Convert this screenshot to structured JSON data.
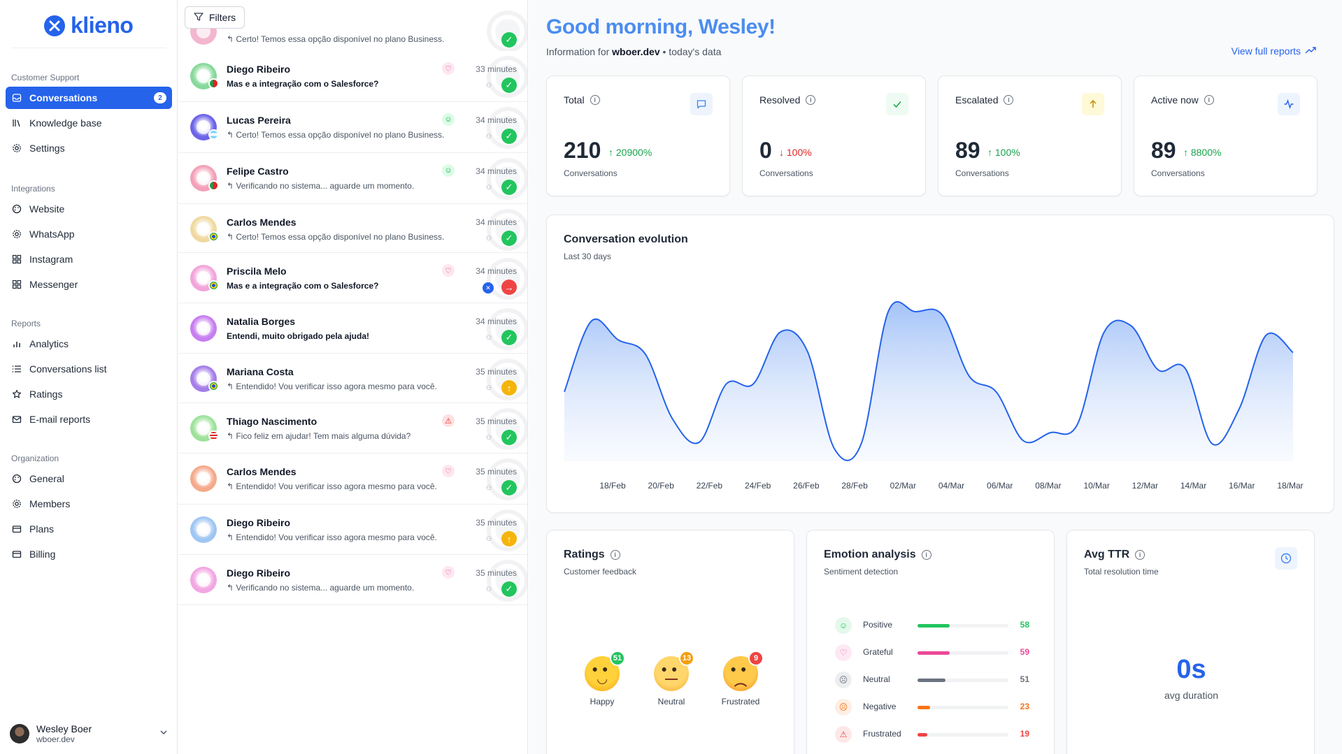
{
  "app": {
    "name": "klieno"
  },
  "sidebar": {
    "sections": [
      {
        "title": "Customer Support",
        "items": [
          {
            "label": "Conversations",
            "icon": "inbox-icon",
            "active": true,
            "badge": "2"
          },
          {
            "label": "Knowledge base",
            "icon": "library-icon"
          },
          {
            "label": "Settings",
            "icon": "gear-icon"
          }
        ]
      },
      {
        "title": "Integrations",
        "items": [
          {
            "label": "Website",
            "icon": "palette-icon"
          },
          {
            "label": "WhatsApp",
            "icon": "gear-icon"
          },
          {
            "label": "Instagram",
            "icon": "grid-icon"
          },
          {
            "label": "Messenger",
            "icon": "grid-icon"
          }
        ]
      },
      {
        "title": "Reports",
        "items": [
          {
            "label": "Analytics",
            "icon": "bar-chart-icon"
          },
          {
            "label": "Conversations list",
            "icon": "list-icon"
          },
          {
            "label": "Ratings",
            "icon": "star-icon"
          },
          {
            "label": "E-mail reports",
            "icon": "mail-icon"
          }
        ]
      },
      {
        "title": "Organization",
        "items": [
          {
            "label": "General",
            "icon": "palette-icon"
          },
          {
            "label": "Members",
            "icon": "gear-icon"
          },
          {
            "label": "Plans",
            "icon": "card-icon"
          },
          {
            "label": "Billing",
            "icon": "card-icon"
          }
        ]
      }
    ],
    "user": {
      "name": "Wesley Boer",
      "domain": "wboer.dev"
    }
  },
  "conversations": {
    "filters_label": "Filters",
    "partial_top": {
      "message": "Certo! Temos essa opção disponível no plano Business.",
      "status": "resolved"
    },
    "items": [
      {
        "name": "Diego Ribeiro",
        "time": "33 minutes",
        "message": "Mas e a integração com o Salesforce?",
        "unread": true,
        "emotion": "heart",
        "status": "resolved",
        "avatar": "#86d99a",
        "flag": "portugal"
      },
      {
        "name": "Lucas Pereira",
        "time": "34 minutes",
        "message": "Certo! Temos essa opção disponível no plano Business.",
        "unread": false,
        "emotion": "smile",
        "status": "resolved",
        "avatar": "#6b63e8",
        "flag": "argentina"
      },
      {
        "name": "Felipe Castro",
        "time": "34 minutes",
        "message": "Verificando no sistema... aguarde um momento.",
        "unread": false,
        "emotion": "smile",
        "status": "resolved",
        "avatar": "#f3a0b8",
        "flag": "portugal"
      },
      {
        "name": "Carlos Mendes",
        "time": "34 minutes",
        "message": "Certo! Temos essa opção disponível no plano Business.",
        "unread": false,
        "emotion": "none",
        "status": "resolved",
        "avatar": "#f0d9a0",
        "flag": "brazil"
      },
      {
        "name": "Priscila Melo",
        "time": "34 minutes",
        "message": "Mas e a integração com o Salesforce?",
        "unread": true,
        "emotion": "heart",
        "status": "escalated-out",
        "avatar": "#f2a4da",
        "flag": "brazil"
      },
      {
        "name": "Natalia Borges",
        "time": "34 minutes",
        "message": "Entendi, muito obrigado pela ajuda!",
        "unread": true,
        "emotion": "none",
        "status": "resolved",
        "avatar": "#c77df0",
        "flag": "none"
      },
      {
        "name": "Mariana Costa",
        "time": "35 minutes",
        "message": "Entendido! Vou verificar isso agora mesmo para você.",
        "unread": false,
        "emotion": "none",
        "status": "escalated",
        "avatar": "#a57de8",
        "flag": "brazil"
      },
      {
        "name": "Thiago Nascimento",
        "time": "35 minutes",
        "message": "Fico feliz em ajudar! Tem mais alguma dúvida?",
        "unread": false,
        "emotion": "warning",
        "status": "resolved",
        "avatar": "#9ee29a",
        "flag": "usa"
      },
      {
        "name": "Carlos Mendes",
        "time": "35 minutes",
        "message": "Entendido! Vou verificar isso agora mesmo para você.",
        "unread": false,
        "emotion": "heart",
        "status": "resolved",
        "avatar": "#f4a98a",
        "flag": "none"
      },
      {
        "name": "Diego Ribeiro",
        "time": "35 minutes",
        "message": "Entendido! Vou verificar isso agora mesmo para você.",
        "unread": false,
        "emotion": "none",
        "status": "escalated",
        "avatar": "#9ec6f2",
        "flag": "none"
      },
      {
        "name": "Diego Ribeiro",
        "time": "35 minutes",
        "message": "Verificando no sistema... aguarde um momento.",
        "unread": false,
        "emotion": "heart",
        "status": "resolved",
        "avatar": "#f2a6e2",
        "flag": "none"
      }
    ]
  },
  "header": {
    "greeting": "Good morning, Wesley!",
    "info_prefix": "Information for",
    "info_domain": "wboer.dev",
    "info_suffix": "• today's data",
    "view_full": "View full reports"
  },
  "stats": [
    {
      "label": "Total",
      "value": "210",
      "delta": "20900%",
      "direction": "up",
      "sub": "Conversations",
      "icon": "message-icon",
      "icon_color": "#3b82f6",
      "icon_bg": "#eef4fd",
      "delta_color": "#16a34a"
    },
    {
      "label": "Resolved",
      "value": "0",
      "delta": "100%",
      "direction": "down",
      "sub": "Conversations",
      "icon": "check-icon",
      "icon_color": "#16a34a",
      "icon_bg": "#eefbf2",
      "delta_color": "#dc2626"
    },
    {
      "label": "Escalated",
      "value": "89",
      "delta": "100%",
      "direction": "up",
      "sub": "Conversations",
      "icon": "arrow-up-icon",
      "icon_color": "#ca8a04",
      "icon_bg": "#fef9d7",
      "delta_color": "#16a34a"
    },
    {
      "label": "Active now",
      "value": "89",
      "delta": "8800%",
      "direction": "up",
      "sub": "Conversations",
      "icon": "activity-icon",
      "icon_color": "#2563eb",
      "icon_bg": "#eef4fd",
      "delta_color": "#16a34a"
    }
  ],
  "evolution": {
    "title": "Conversation evolution",
    "subtitle": "Last 30 days"
  },
  "chart_data": {
    "type": "area",
    "title": "Conversation evolution",
    "subtitle": "Last 30 days",
    "x": [
      "17/Feb",
      "18/Feb",
      "19/Feb",
      "20/Feb",
      "21/Feb",
      "22/Feb",
      "23/Feb",
      "24/Feb",
      "25/Feb",
      "26/Feb",
      "27/Feb",
      "28/Feb",
      "01/Mar",
      "02/Mar",
      "03/Mar",
      "04/Mar",
      "05/Mar",
      "06/Mar",
      "07/Mar",
      "08/Mar",
      "09/Mar",
      "10/Mar",
      "11/Mar",
      "12/Mar",
      "13/Mar",
      "14/Mar",
      "15/Mar",
      "16/Mar",
      "17/Mar",
      "18/Mar"
    ],
    "tick_labels": [
      "18/Feb",
      "20/Feb",
      "22/Feb",
      "24/Feb",
      "26/Feb",
      "28/Feb",
      "02/Mar",
      "04/Mar",
      "06/Mar",
      "08/Mar",
      "10/Mar",
      "12/Mar",
      "14/Mar",
      "16/Mar",
      "18/Mar"
    ],
    "values": [
      0.41,
      0.86,
      0.74,
      0.65,
      0.24,
      0.09,
      0.46,
      0.46,
      0.79,
      0.67,
      0.05,
      0.08,
      0.92,
      0.92,
      0.9,
      0.51,
      0.41,
      0.1,
      0.15,
      0.2,
      0.79,
      0.83,
      0.55,
      0.56,
      0.08,
      0.3,
      0.77,
      0.66
    ],
    "grid": false,
    "legend": "none"
  },
  "ratings": {
    "title": "Ratings",
    "subtitle": "Customer feedback",
    "items": [
      {
        "label": "Happy",
        "count": "51",
        "badge_color": "#22c55e"
      },
      {
        "label": "Neutral",
        "count": "13",
        "badge_color": "#f59e0b"
      },
      {
        "label": "Frustrated",
        "count": "9",
        "badge_color": "#ef4444"
      }
    ]
  },
  "emotion": {
    "title": "Emotion analysis",
    "subtitle": "Sentiment detection",
    "items": [
      {
        "label": "Positive",
        "value": 58,
        "display": "58",
        "color": "#22c55e",
        "icon": "smile-icon"
      },
      {
        "label": "Grateful",
        "value": 59,
        "display": "59",
        "color": "#ec4899",
        "icon": "heart-icon"
      },
      {
        "label": "Neutral",
        "value": 51,
        "display": "51",
        "color": "#6b7280",
        "icon": "meh-icon"
      },
      {
        "label": "Negative",
        "value": 23,
        "display": "23",
        "color": "#f97316",
        "icon": "frown-icon"
      },
      {
        "label": "Frustrated",
        "value": 19,
        "display": "19",
        "color": "#ef4444",
        "icon": "warning-icon"
      }
    ]
  },
  "ttr": {
    "title": "Avg TTR",
    "subtitle": "Total resolution time",
    "value": "0s",
    "caption": "avg duration"
  }
}
